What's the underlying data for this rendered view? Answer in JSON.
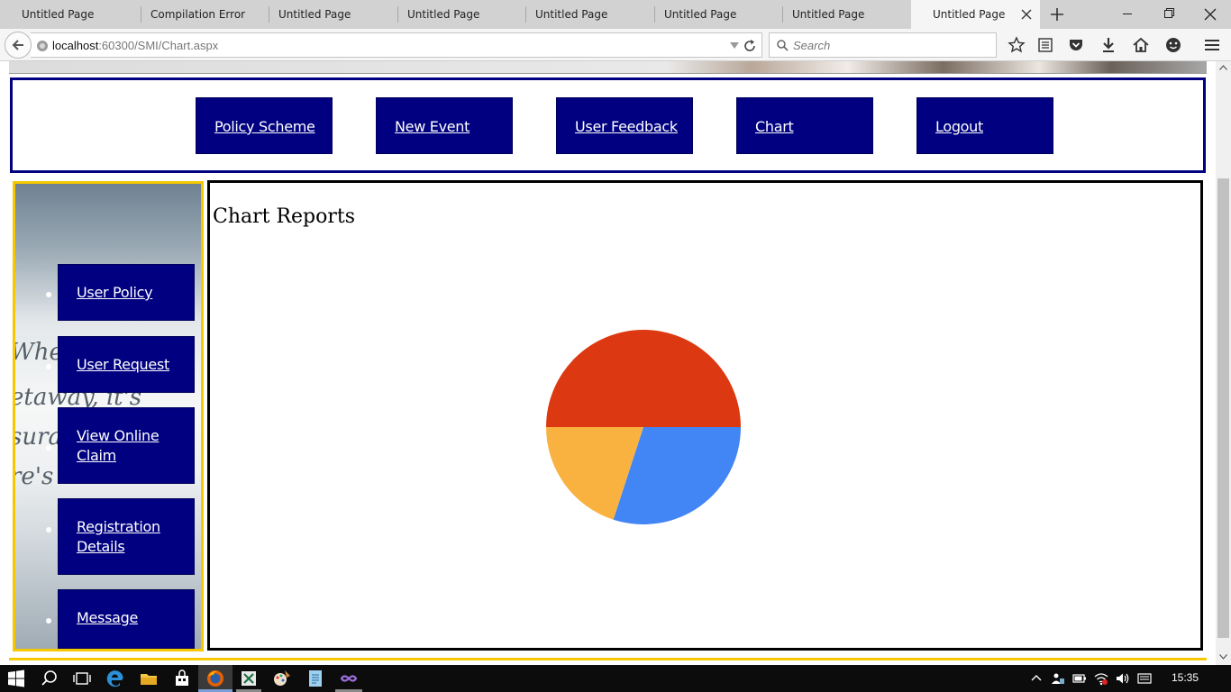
{
  "browser": {
    "tabs": [
      {
        "title": "Untitled Page"
      },
      {
        "title": "Compilation Error"
      },
      {
        "title": "Untitled Page"
      },
      {
        "title": "Untitled Page"
      },
      {
        "title": "Untitled Page"
      },
      {
        "title": "Untitled Page"
      },
      {
        "title": "Untitled Page"
      },
      {
        "title": "Untitled Page"
      }
    ],
    "active_tab_index": 7,
    "url_host": "localhost",
    "url_rest": ":60300/SMI/Chart.aspx",
    "search_placeholder": "Search"
  },
  "topnav": {
    "items": [
      {
        "label": "Policy Scheme"
      },
      {
        "label": "New Event"
      },
      {
        "label": "User Feedback"
      },
      {
        "label": "Chart"
      },
      {
        "label": "Logout"
      }
    ]
  },
  "sidebar": {
    "items": [
      {
        "label": "User Policy"
      },
      {
        "label": "User Request"
      },
      {
        "label": "View Online Claim"
      },
      {
        "label": "Registration Details"
      },
      {
        "label": "Message"
      }
    ]
  },
  "content": {
    "title": "Chart Reports"
  },
  "chart_data": {
    "type": "pie",
    "values": [
      50,
      30,
      20
    ],
    "colors": [
      "#dc3912",
      "#4285f4",
      "#f9b240"
    ]
  },
  "taskbar": {
    "time": "15:35"
  }
}
